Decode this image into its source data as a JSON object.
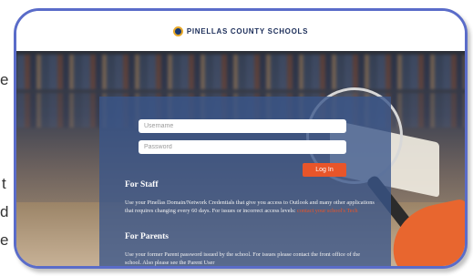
{
  "left_page_fragment": {
    "chars": [
      "e",
      "t",
      "d",
      "e"
    ]
  },
  "header": {
    "brand_text": "PINELLAS COUNTY SCHOOLS",
    "logo_icon": "district-seal-icon"
  },
  "login": {
    "username_placeholder": "Username",
    "password_placeholder": "Password",
    "button_label": "Log In"
  },
  "staff": {
    "title": "For Staff",
    "body": "Use your Pinellas Domain/Network Credentials that give you access to Outlook and many other applications that requires changing every 60 days. For issues or incorrect access levels: ",
    "link_text": "contact your school's Tech"
  },
  "parents": {
    "title": "For Parents",
    "body": "Use your former Parent password issued by the school. For issues please contact the front office of the school. Also please see the Parent User"
  },
  "colors": {
    "frame": "#5a6cc9",
    "panel": "#3a568a",
    "accent": "#e8552a",
    "brand": "#1c2e5a"
  }
}
